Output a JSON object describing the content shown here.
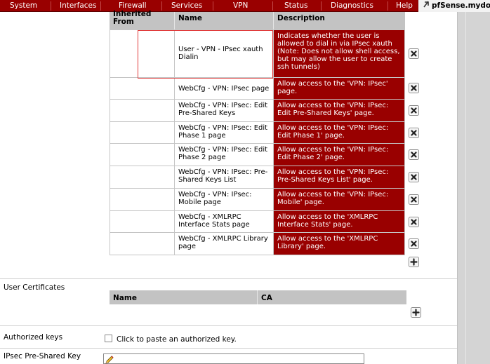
{
  "nav": {
    "items": [
      {
        "label": "System"
      },
      {
        "label": "Interfaces"
      },
      {
        "label": "Firewall"
      },
      {
        "label": "Services"
      },
      {
        "label": "VPN"
      },
      {
        "label": "Status"
      },
      {
        "label": "Diagnostics"
      },
      {
        "label": "Help"
      }
    ],
    "brand": "pfSense.mydo"
  },
  "privileges": {
    "headers": {
      "inherited": "Inherited From",
      "name": "Name",
      "description": "Description"
    },
    "rows": [
      {
        "inherited": "",
        "name": "User - VPN - IPsec xauth Dialin",
        "description": "Indicates whether the user is allowed to dial in via IPsec xauth (Note: Does not allow shell access, but may allow the user to create ssh tunnels)"
      },
      {
        "inherited": "",
        "name": "WebCfg - VPN: IPsec page",
        "description": "Allow access to the 'VPN: IPsec' page."
      },
      {
        "inherited": "",
        "name": "WebCfg - VPN: IPsec: Edit Pre-Shared Keys",
        "description": "Allow access to the 'VPN: IPsec: Edit Pre-Shared Keys' page."
      },
      {
        "inherited": "",
        "name": "WebCfg - VPN: IPsec: Edit Phase 1 page",
        "description": "Allow access to the 'VPN: IPsec: Edit Phase 1' page."
      },
      {
        "inherited": "",
        "name": "WebCfg - VPN: IPsec: Edit Phase 2 page",
        "description": "Allow access to the 'VPN: IPsec: Edit Phase 2' page."
      },
      {
        "inherited": "",
        "name": "WebCfg - VPN: IPsec: Pre-Shared Keys List",
        "description": "Allow access to the 'VPN: IPsec: Pre-Shared Keys List' page."
      },
      {
        "inherited": "",
        "name": "WebCfg - VPN: IPsec: Mobile page",
        "description": "Allow access to the 'VPN: IPsec: Mobile' page."
      },
      {
        "inherited": "",
        "name": "WebCfg - XMLRPC Interface Stats page",
        "description": "Allow access to the 'XMLRPC Interface Stats' page."
      },
      {
        "inherited": "",
        "name": "WebCfg - XMLRPC Library page",
        "description": "Allow access to the 'XMLRPC Library' page."
      }
    ]
  },
  "user_certificates": {
    "label": "User Certificates",
    "headers": {
      "name": "Name",
      "ca": "CA"
    }
  },
  "authorized_keys": {
    "label": "Authorized keys",
    "checkbox_label": "Click to paste an authorized key."
  },
  "ipsec_psk": {
    "label": "IPsec Pre-Shared Key"
  },
  "colors": {
    "nav_bg": "#990000",
    "desc_bg": "#990000",
    "header_bg": "#c3c3c3"
  }
}
